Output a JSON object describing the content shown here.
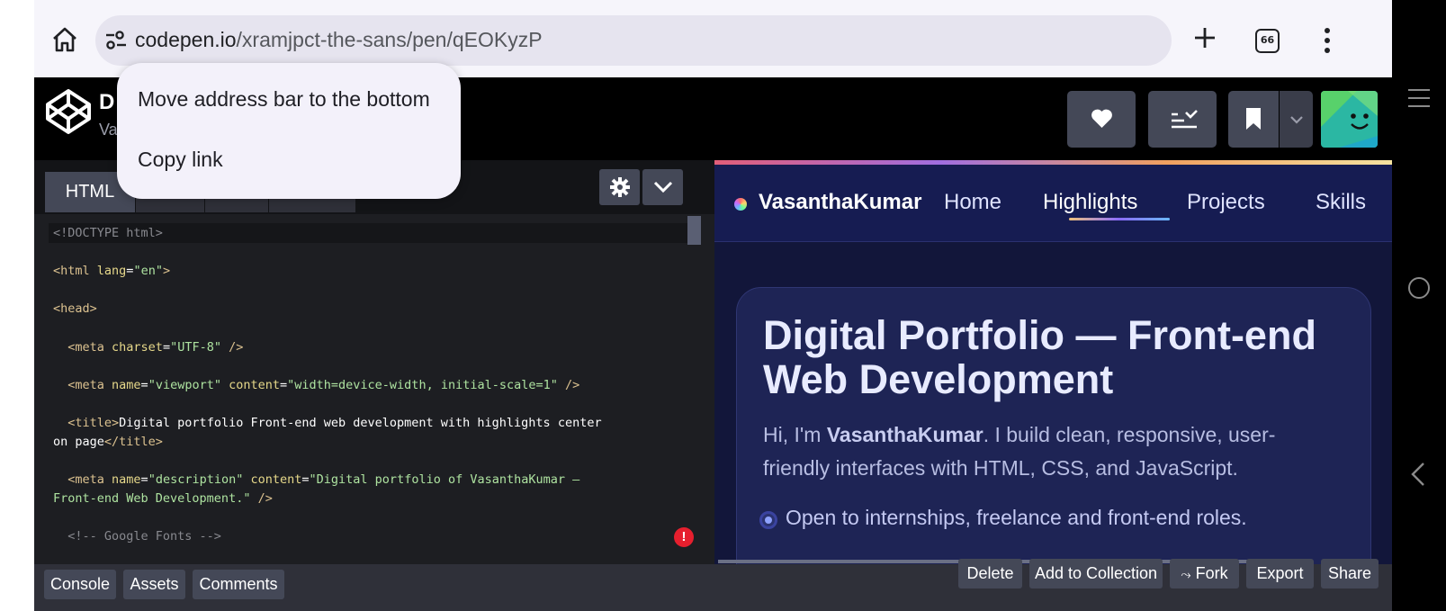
{
  "browser": {
    "url_host": "codepen.io",
    "url_path": "/xramjpct-the-sans/pen/qEOKyzP",
    "tab_count": "66"
  },
  "popup_menu": {
    "items": [
      "Move address bar to the bottom",
      "Copy link"
    ]
  },
  "codepen": {
    "pen_title_partial": "D",
    "author_partial": "Va"
  },
  "editor": {
    "active_tab": "HTML",
    "code_lines": [
      {
        "parts": [
          {
            "c": "cm",
            "t": "<!DOCTYPE html>"
          }
        ]
      },
      {
        "parts": [
          {
            "c": "tg",
            "t": "<html "
          },
          {
            "c": "at",
            "t": "lang"
          },
          {
            "c": "txt",
            "t": "="
          },
          {
            "c": "st",
            "t": "\"en\""
          },
          {
            "c": "tg",
            "t": ">"
          }
        ]
      },
      {
        "parts": [
          {
            "c": "tg",
            "t": "<head>"
          }
        ]
      },
      {
        "parts": [
          {
            "c": "tg",
            "t": "  <meta "
          },
          {
            "c": "at",
            "t": "charset"
          },
          {
            "c": "txt",
            "t": "="
          },
          {
            "c": "st",
            "t": "\"UTF-8\""
          },
          {
            "c": "tg",
            "t": " />"
          }
        ]
      },
      {
        "parts": [
          {
            "c": "tg",
            "t": "  <meta "
          },
          {
            "c": "at",
            "t": "name"
          },
          {
            "c": "txt",
            "t": "="
          },
          {
            "c": "st",
            "t": "\"viewport\""
          },
          {
            "c": "at",
            "t": " content"
          },
          {
            "c": "txt",
            "t": "="
          },
          {
            "c": "st",
            "t": "\"width=device-width, initial-scale=1\""
          },
          {
            "c": "tg",
            "t": " />"
          }
        ]
      },
      {
        "parts": [
          {
            "c": "tg",
            "t": "  <title>"
          },
          {
            "c": "txt",
            "t": "Digital portfolio Front-end web development with highlights center"
          }
        ]
      },
      {
        "parts": [
          {
            "c": "txt",
            "t": "on page"
          },
          {
            "c": "tg",
            "t": "</title>"
          }
        ]
      },
      {
        "parts": [
          {
            "c": "tg",
            "t": "  <meta "
          },
          {
            "c": "at",
            "t": "name"
          },
          {
            "c": "txt",
            "t": "="
          },
          {
            "c": "st",
            "t": "\"description\""
          },
          {
            "c": "at",
            "t": " content"
          },
          {
            "c": "txt",
            "t": "="
          },
          {
            "c": "st",
            "t": "\"Digital portfolio of VasanthaKumar —"
          }
        ]
      },
      {
        "parts": [
          {
            "c": "st",
            "t": "Front-end Web Development.\""
          },
          {
            "c": "tg",
            "t": " />"
          }
        ]
      },
      {
        "parts": [
          {
            "c": "cm",
            "t": "  <!-- Google Fonts -->"
          }
        ]
      }
    ]
  },
  "preview": {
    "brand": "VasanthaKumar",
    "nav_links": [
      "Home",
      "Highlights",
      "Projects",
      "Skills"
    ],
    "active_link": "Highlights",
    "heading": "Digital Portfolio — Front-end Web Development",
    "intro_prefix": "Hi, I'm ",
    "intro_name": "VasanthaKumar",
    "intro_suffix": ". I build clean, responsive, user-friendly interfaces with HTML, CSS, and JavaScript.",
    "status": "Open to internships, freelance and front-end roles."
  },
  "footer": {
    "left_buttons": [
      "Console",
      "Assets",
      "Comments"
    ],
    "right_buttons": [
      "Delete",
      "Add to Collection",
      "Fork",
      "Export",
      "Share"
    ]
  }
}
